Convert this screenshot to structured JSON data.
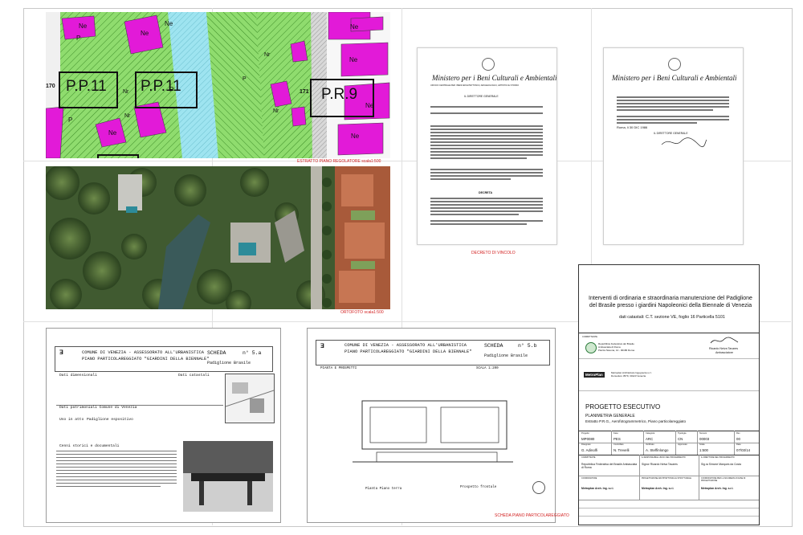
{
  "map_panel": {
    "zones": [
      {
        "label": "P.P.11"
      },
      {
        "label": "P.P.11"
      },
      {
        "label": "P.R.9"
      }
    ],
    "row_numbers": [
      "170",
      "171"
    ],
    "small_labels": [
      "P",
      "P",
      "Nr",
      "Ne",
      "Ne",
      "Ne",
      "P",
      "Nr",
      "Nr",
      "Ne",
      "Ne",
      "Ne",
      "P",
      "Nr",
      "Ne",
      "Ne"
    ],
    "caption": "ESTRATTO PIANO REGOLATORE scala1:500"
  },
  "ortho_panel": {
    "caption": "ORTOFOTO scala1:500"
  },
  "letter1": {
    "header": "Ministero per i Beni Culturali e Ambientali",
    "office": "UFFICIO CENTRALE PER I BENI ARCHITETTONICI, ARCHEOLOGICI, ARTISTICI E STORICI",
    "director": "IL DIRETTORE GENERALE",
    "section": "DECRETA",
    "caption": "DECRETO DI VINCOLO"
  },
  "letter2": {
    "header": "Ministero per i Beni Culturali e Ambientali",
    "place_date": "Roma, li 30 DIC 1986",
    "signature": "IL DIRETTORE GENERALE"
  },
  "sheet1": {
    "title1": "COMUNE DI VENEZIA - ASSESSORATO ALL'URBANISTICA",
    "title2": "PIANO PARTICOLAREGGIATO \"GIARDINI DELLA BIENNALE\"",
    "scheda": "SCHEDA",
    "scheda_no": "n° 5.a",
    "pavilion": "Padiglione Brasile",
    "dati_dimensionali": "Dati dimensionali",
    "dati_catastali": "Dati catastali",
    "dati_patrimoniali": "Dati patrimoniali Comune di Venezia",
    "uso_attuale": "Uso in atto",
    "uso_value": "Padiglione espositivo",
    "cenni": "Cenni storici e documentali"
  },
  "sheet2": {
    "title1": "COMUNE DI VENEZIA - ASSESSORATO ALL'URBANISTICA",
    "title2": "PIANO PARTICOLAREGGIATO \"GIARDINI DELLA BIENNALE\"",
    "scheda": "SCHEDA",
    "scheda_no": "n° 5.b",
    "pavilion": "Padiglione Brasile",
    "piante": "PIANTA E PROSPETTI",
    "scala": "SCALA 1:200",
    "pianta_label": "Pianta Piano terra",
    "prospetto_label": "Prospetto frontale",
    "caption": "SCHEDA PIANO PARTICOLAREGGIATO"
  },
  "title_block": {
    "project_title": "Interventi di ordinaria e straordinaria manutenzione del Padiglione del Brasile presso i giardini Napoleonici della Biennale di Venezia",
    "cadastral": "dati catastali: C.T. sezione VE, foglio 16 Particella 5101",
    "committente_label": "COMMITTENTE",
    "committente_lines": [
      "Repubblica Federativa del Brasile",
      "Ambasciata di Roma",
      "Piazza Navona, 14 - 00186 Roma"
    ],
    "ambassador": "Ricardo Neiva Tavares",
    "ambassador_role": "Ambasciatore",
    "firm_logo": "MetroPlan",
    "firm_lines": [
      "Metroplan Architettura Ingegneria s.r.l.",
      "Dorsoduro 3579, 30123 Venezia"
    ],
    "phase": "PROGETTO ESECUTIVO",
    "sheet_title1": "PLANIMETRIA GENERALE",
    "sheet_title2": "Estratto P.R.G., Aerofotogrammetrico, Piano particolareggiato",
    "table_headers": [
      "Progetto",
      "Fase",
      "Categoria",
      "Tipologia",
      "Numero",
      "Rev"
    ],
    "table_values": [
      "MP0080",
      "PES",
      "ARC",
      "CN",
      "00003",
      "00"
    ],
    "table_headers2": [
      "Disegnato",
      "Controllato",
      "Verificato",
      "Approvato",
      "Scala",
      "Data"
    ],
    "table_values2": [
      "G. Adinolfi",
      "N. Trevelli",
      "A. Steffinlongo",
      "",
      "1:500",
      "07/03/14"
    ],
    "bottom_headers": [
      "COMMITTENTE",
      "IL RESPONSABILE UNICO DEL PROCEDIMENTO",
      "IL DIRETTORE DEL PROCEDIMENTO"
    ],
    "bottom_values": [
      "Repubblica Federativa del Brasile Ambasciata di Roma",
      "Signor Ricardo Neiva Tavares",
      "Sig.ra Simone Marques da Costa"
    ],
    "bottom_headers2": [
      "COORDINATORE",
      "PROGETTAZIONE ARCHITETTONICA E STRUTTURALE",
      "COORDINATORE PER LA SICUREZZA IN FASE DI PROGETTAZIONE"
    ],
    "bottom_values2": [
      "Metroplan Arch. Ing. s.r.l.",
      "Metroplan Arch. Ing. s.r.l.",
      "Metroplan Arch. Ing. s.r.l."
    ]
  },
  "colors": {
    "green_zone": "#8fdc6e",
    "magenta_building": "#e21ad8",
    "cyan_canal": "#9ee4f0",
    "caption_red": "#d21e1e"
  }
}
